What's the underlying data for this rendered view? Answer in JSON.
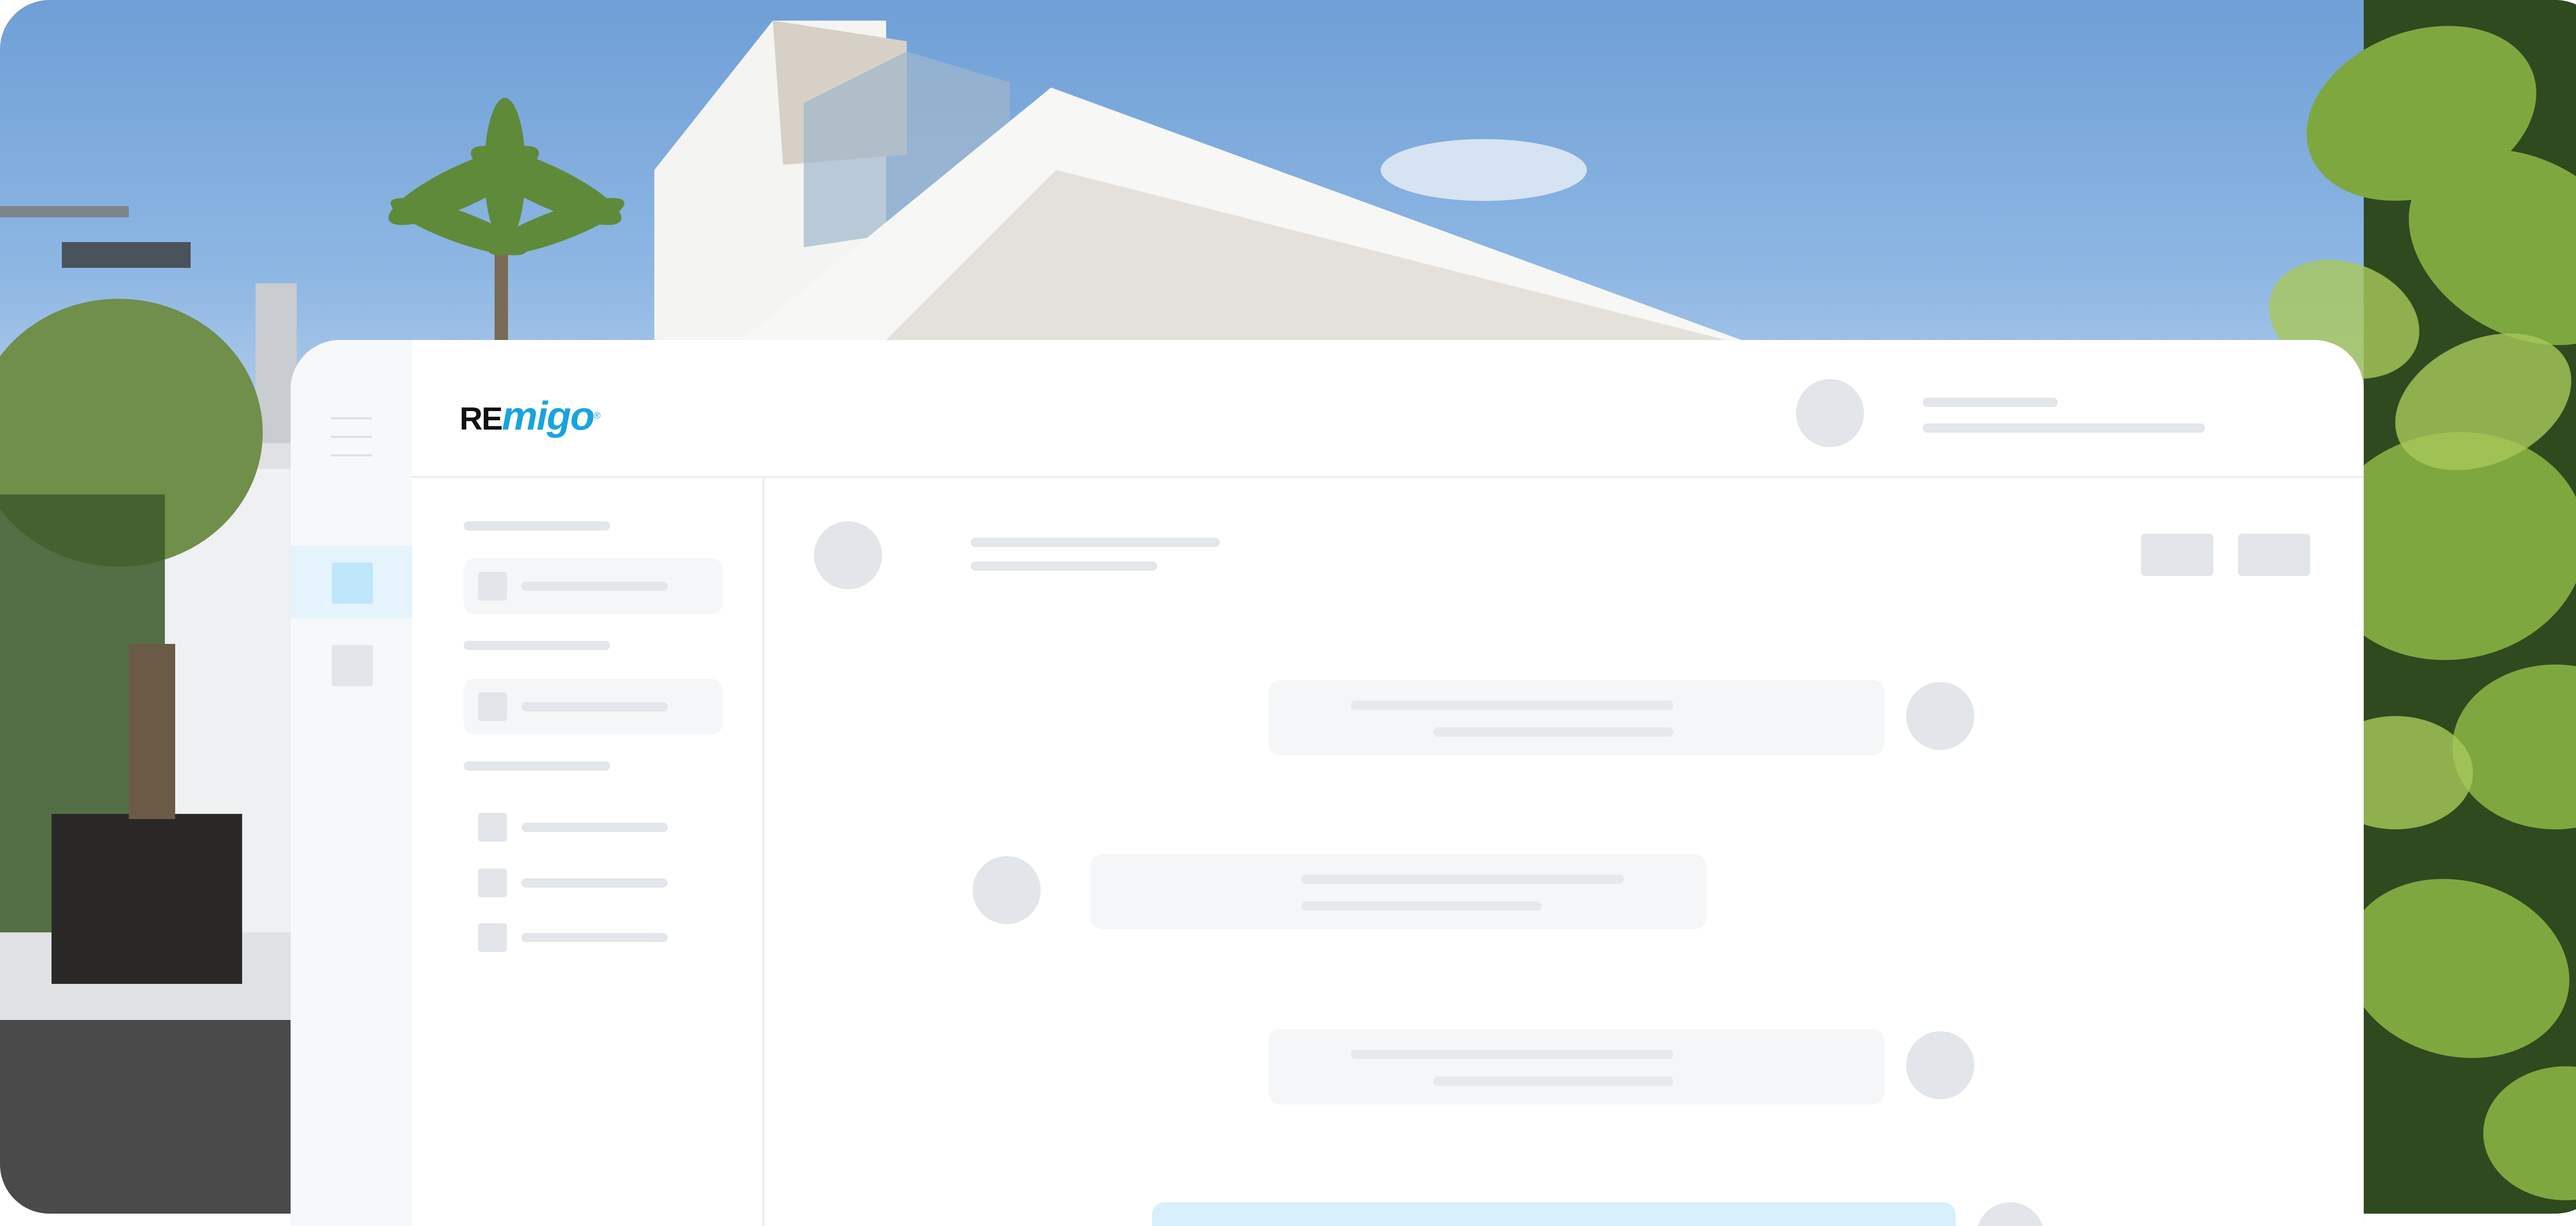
{
  "brand": {
    "logo_text_re": "RE",
    "logo_text_migo": "migo",
    "logo_mark": "®",
    "logo_color_dark": "#111111",
    "logo_color_accent": "#1aa3e0"
  },
  "colors": {
    "sidebar_active": "#e4f3fc",
    "sidebar_active_square": "#bfe6fb",
    "placeholder": "#e2e5e9",
    "bubble": "#f5f6f8"
  },
  "icons": {
    "menu": "hamburger-icon"
  }
}
